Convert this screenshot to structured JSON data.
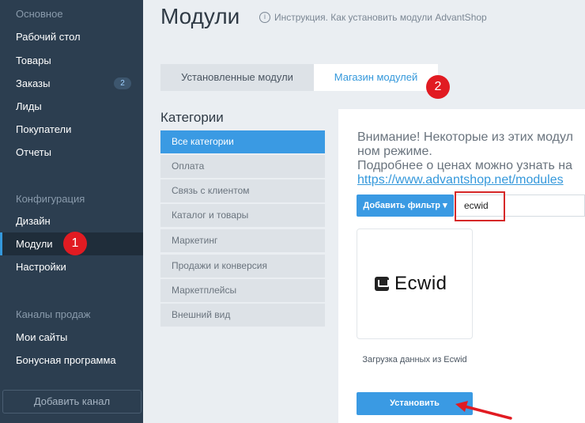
{
  "sidebar": {
    "group_main": "Основное",
    "items_main": [
      {
        "label": "Рабочий стол"
      },
      {
        "label": "Товары"
      },
      {
        "label": "Заказы",
        "badge": "2"
      },
      {
        "label": "Лиды"
      },
      {
        "label": "Покупатели"
      },
      {
        "label": "Отчеты"
      }
    ],
    "group_config": "Конфигурация",
    "items_config": [
      {
        "label": "Дизайн"
      },
      {
        "label": "Модули"
      },
      {
        "label": "Настройки"
      }
    ],
    "group_channels": "Каналы продаж",
    "items_channels": [
      {
        "label": "Мои сайты"
      },
      {
        "label": "Бонусная программа"
      }
    ],
    "add_channel": "Добавить канал"
  },
  "header": {
    "title": "Модули",
    "help_text": "Инструкция. Как установить модули AdvantShop",
    "help_icon": "chat-help-icon"
  },
  "tabs": [
    {
      "label": "Установленные модули"
    },
    {
      "label": "Магазин модулей"
    }
  ],
  "categories": {
    "title": "Категории",
    "items": [
      "Все категории",
      "Оплата",
      "Связь с клиентом",
      "Каталог и товары",
      "Маркетинг",
      "Продажи и конверсия",
      "Маркетплейсы",
      "Внешний вид"
    ]
  },
  "notice": {
    "line1": "Внимание! Некоторые из этих модул",
    "line2": "ном режиме.",
    "line3": "Подробнее о ценах можно узнать на",
    "link": "https://www.advantshop.net/modules"
  },
  "filter": {
    "add_label": "Добавить фильтр ▾",
    "search_value": "ecwid"
  },
  "module_card": {
    "logo_text": "Ecwid",
    "caption": "Загрузка данных из Ecwid",
    "install_label": "Установить"
  },
  "markers": {
    "m1": "1",
    "m2": "2"
  },
  "colors": {
    "accent": "#3a9ae3",
    "sidebar": "#2c3e50",
    "marker": "#e11b22"
  }
}
